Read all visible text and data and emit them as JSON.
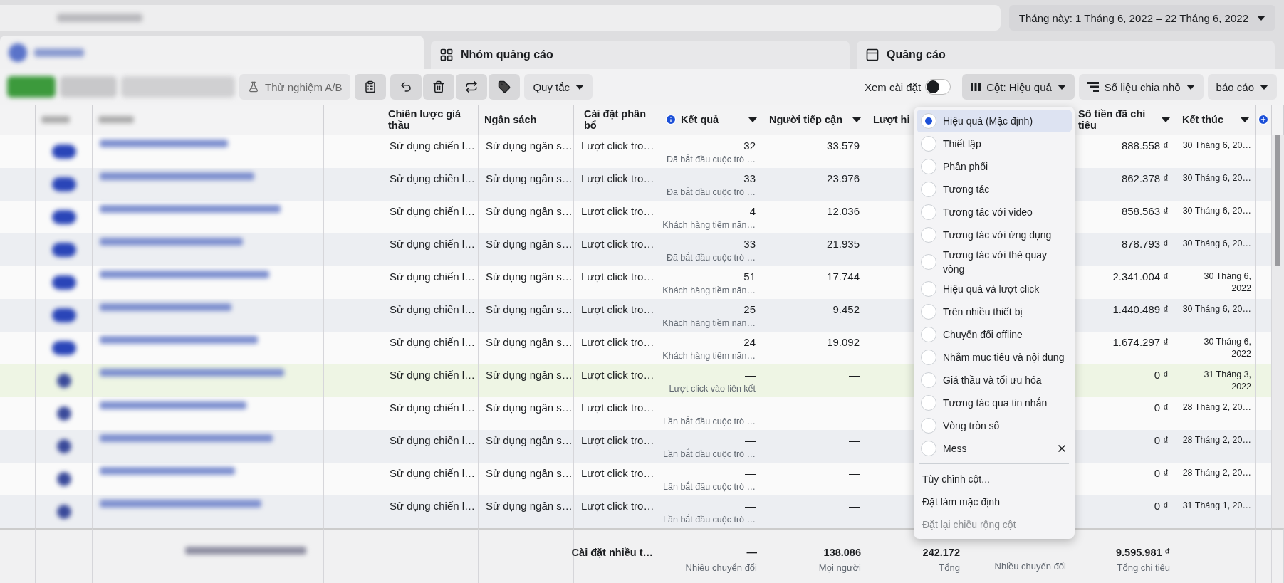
{
  "top_bar": {
    "date_range": "Tháng này: 1 Tháng 6, 2022 – 22 Tháng 6, 2022"
  },
  "tabs": [
    {
      "kind": "blurred",
      "selected": true
    },
    {
      "kind": "grid",
      "label": "Nhóm quảng cáo",
      "selected": false
    },
    {
      "kind": "window",
      "label": "Quảng cáo",
      "selected": false
    }
  ],
  "toolbar": {
    "ab_test": "Thử nghiệm A/B",
    "rules": "Quy tắc",
    "view_settings": {
      "label": "Xem cài đặt",
      "on": false
    },
    "columns": "Cột: Hiệu quả",
    "breakdown": "Số liệu chia nhỏ",
    "reports": "báo cáo"
  },
  "table": {
    "columns": [
      {
        "label": "Chiến lược giá thầu",
        "info": false,
        "sortable": false
      },
      {
        "label": "Ngân sách",
        "info": false,
        "sortable": false
      },
      {
        "label": "Cài đặt phân bổ",
        "info": false,
        "sortable": false
      },
      {
        "label": "Kết quả",
        "info": true,
        "sortable": true
      },
      {
        "label": "Người tiếp cận",
        "info": false,
        "sortable": true
      },
      {
        "label": "Lượt hi",
        "info": false
      },
      {
        "label": "Số tiền đã chi tiêu",
        "info": false,
        "sortable": true
      },
      {
        "label": "Kết thúc",
        "info": false,
        "sortable": true
      }
    ],
    "rows": [
      {
        "highlighted": false,
        "active": true,
        "bid": "Sử dụng chiến l…",
        "budget": "Sử dụng ngân s…",
        "attribution": "Lượt click tro…",
        "result": "32",
        "result_label": "Đã bắt đầu cuộc trò …",
        "reach": "33.579",
        "spent": "888.558 ₫",
        "end": "30 Tháng 6, 20…"
      },
      {
        "highlighted": false,
        "active": true,
        "bid": "Sử dụng chiến l…",
        "budget": "Sử dụng ngân s…",
        "attribution": "Lượt click tro…",
        "result": "33",
        "result_label": "Đã bắt đầu cuộc trò …",
        "reach": "23.976",
        "spent": "862.378 ₫",
        "end": "30 Tháng 6, 20…"
      },
      {
        "highlighted": false,
        "active": true,
        "bid": "Sử dụng chiến l…",
        "budget": "Sử dụng ngân s…",
        "attribution": "Lượt click tro…",
        "result": "4",
        "result_label": "Khách hàng tiềm năn…",
        "reach": "12.036",
        "spent": "858.563 ₫",
        "end": "30 Tháng 6, 20…"
      },
      {
        "highlighted": false,
        "active": true,
        "bid": "Sử dụng chiến l…",
        "budget": "Sử dụng ngân s…",
        "attribution": "Lượt click tro…",
        "result": "33",
        "result_label": "Đã bắt đầu cuộc trò …",
        "reach": "21.935",
        "spent": "878.793 ₫",
        "end": "30 Tháng 6, 20…"
      },
      {
        "highlighted": false,
        "active": true,
        "bid": "Sử dụng chiến l…",
        "budget": "Sử dụng ngân s…",
        "attribution": "Lượt click tro…",
        "result": "51",
        "result_label": "Khách hàng tiềm năn…",
        "reach": "17.744",
        "spent": "2.341.004 ₫",
        "end": "30 Tháng 6, 2022"
      },
      {
        "highlighted": false,
        "active": true,
        "bid": "Sử dụng chiến l…",
        "budget": "Sử dụng ngân s…",
        "attribution": "Lượt click tro…",
        "result": "25",
        "result_label": "Khách hàng tiềm năn…",
        "reach": "9.452",
        "spent": "1.440.489 ₫",
        "end": "30 Tháng 6, 20…"
      },
      {
        "highlighted": false,
        "active": true,
        "bid": "Sử dụng chiến l…",
        "budget": "Sử dụng ngân s…",
        "attribution": "Lượt click tro…",
        "result": "24",
        "result_label": "Khách hàng tiềm năn…",
        "reach": "19.092",
        "spent": "1.674.297 ₫",
        "end": "30 Tháng 6, 2022"
      },
      {
        "highlighted": true,
        "active": false,
        "bid": "Sử dụng chiến l…",
        "budget": "Sử dụng ngân s…",
        "attribution": "Lượt click tro…",
        "result": "—",
        "result_label": "Lượt click vào liên kết",
        "reach": "—",
        "spent": "0 ₫",
        "end": "31 Tháng 3, 2022"
      },
      {
        "highlighted": false,
        "active": false,
        "bid": "Sử dụng chiến l…",
        "budget": "Sử dụng ngân s…",
        "attribution": "Lượt click tro…",
        "result": "—",
        "result_label": "Lần bắt đầu cuộc trò …",
        "reach": "—",
        "spent": "0 ₫",
        "end": "28 Tháng 2, 20…"
      },
      {
        "highlighted": false,
        "active": false,
        "bid": "Sử dụng chiến l…",
        "budget": "Sử dụng ngân s…",
        "attribution": "Lượt click tro…",
        "result": "—",
        "result_label": "Lần bắt đầu cuộc trò …",
        "reach": "—",
        "spent": "0 ₫",
        "end": "28 Tháng 2, 20…"
      },
      {
        "highlighted": false,
        "active": false,
        "bid": "Sử dụng chiến l…",
        "budget": "Sử dụng ngân s…",
        "attribution": "Lượt click tro…",
        "result": "—",
        "result_label": "Lần bắt đầu cuộc trò …",
        "reach": "—",
        "spent": "0 ₫",
        "end": "28 Tháng 2, 20…"
      },
      {
        "highlighted": false,
        "active": false,
        "bid": "Sử dụng chiến l…",
        "budget": "Sử dụng ngân s…",
        "attribution": "Lượt click tro…",
        "result": "—",
        "result_label": "Lần bắt đầu cuộc trò …",
        "reach": "—",
        "spent": "0 ₫",
        "end": "31 Tháng 1, 20…"
      }
    ],
    "footer": {
      "attribution": "Cài đặt nhiều t…",
      "result": "—",
      "result_label": "Nhiều chuyển đổi",
      "reach": "138.086",
      "reach_label": "Mọi người",
      "impressions": "242.172",
      "impressions_label": "Tổng",
      "column_7_label": "Nhiều chuyển đổi",
      "spent": "9.595.981 ₫",
      "spent_label": "Tổng chi tiêu"
    }
  },
  "columns_menu": {
    "presets": [
      {
        "label": "Hiệu quả (Mặc định)",
        "selected": true,
        "removable": false
      },
      {
        "label": "Thiết lập",
        "selected": false,
        "removable": false
      },
      {
        "label": "Phân phối",
        "selected": false,
        "removable": false
      },
      {
        "label": "Tương tác",
        "selected": false,
        "removable": false
      },
      {
        "label": "Tương tác với video",
        "selected": false,
        "removable": false
      },
      {
        "label": "Tương tác với ứng dụng",
        "selected": false,
        "removable": false
      },
      {
        "label": "Tương tác với thẻ quay vòng",
        "selected": false,
        "removable": false
      },
      {
        "label": "Hiệu quả và lượt click",
        "selected": false,
        "removable": false
      },
      {
        "label": "Trên nhiều thiết bị",
        "selected": false,
        "removable": false
      },
      {
        "label": "Chuyển đổi offline",
        "selected": false,
        "removable": false
      },
      {
        "label": "Nhắm mục tiêu và nội dung",
        "selected": false,
        "removable": false
      },
      {
        "label": "Giá thầu và tối ưu hóa",
        "selected": false,
        "removable": false
      },
      {
        "label": "Tương tác qua tin nhắn",
        "selected": false,
        "removable": false
      },
      {
        "label": "Vòng tròn số",
        "selected": false,
        "removable": false
      },
      {
        "label": "Mess",
        "selected": false,
        "removable": true
      }
    ],
    "actions": [
      {
        "label": "Tùy chỉnh cột...",
        "disabled": false
      },
      {
        "label": "Đặt làm mặc định",
        "disabled": false
      },
      {
        "label": "Đặt lại chiều rộng cột",
        "disabled": true
      }
    ]
  }
}
